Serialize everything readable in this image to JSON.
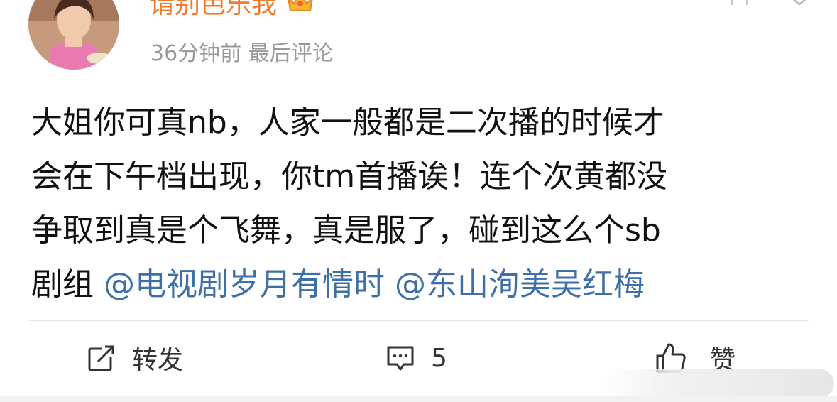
{
  "user": {
    "name": "请别芭乐我",
    "avatar_icon": "avatar-photo",
    "vip_badge_icon": "crown-icon"
  },
  "meta": {
    "time": "36分钟前",
    "label": "最后评论"
  },
  "post": {
    "lines": [
      "大姐你可真nb，人家一般都是二次播的时候才",
      "会在下午档出现，你tm首播诶！连个次黄都没",
      "争取到真是个飞舞，真是服了，碰到这么个sb"
    ],
    "last_line_text": "剧组 ",
    "mentions": [
      "@电视剧岁月有情时",
      "@东山洵美吴红梅"
    ]
  },
  "actions": {
    "repost": {
      "label": "转发",
      "icon": "repost-icon"
    },
    "comment": {
      "count": "5",
      "icon": "comment-icon"
    },
    "like": {
      "label": "赞",
      "icon": "thumbs-up-icon"
    }
  },
  "colors": {
    "username": "#f07b2b",
    "mention": "#3e6fa6",
    "meta": "#9a9a9a",
    "text": "#111111"
  }
}
